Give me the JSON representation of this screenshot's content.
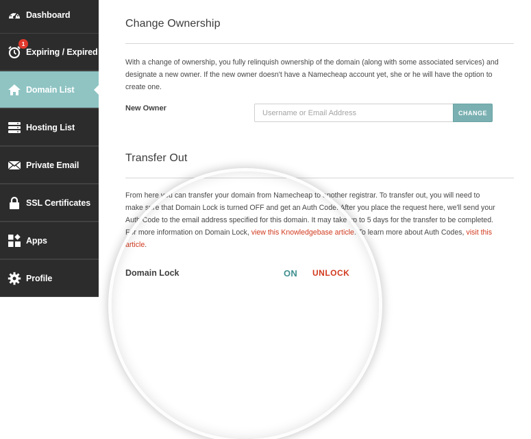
{
  "sidebar": {
    "items": [
      {
        "label": "Dashboard",
        "icon": "dashboard-gauge-icon"
      },
      {
        "label": "Expiring / Expired",
        "icon": "alarm-clock-icon",
        "badge": "1"
      },
      {
        "label": "Domain List",
        "icon": "home-icon",
        "active": true
      },
      {
        "label": "Hosting List",
        "icon": "server-icon"
      },
      {
        "label": "Private Email",
        "icon": "envelope-icon"
      },
      {
        "label": "SSL Certificates",
        "icon": "padlock-icon"
      },
      {
        "label": "Apps",
        "icon": "apps-grid-icon"
      },
      {
        "label": "Profile",
        "icon": "gear-icon"
      }
    ],
    "active_color": "#8fc4c3"
  },
  "change_ownership": {
    "title": "Change Ownership",
    "description": "With a change of ownership, you fully relinquish ownership of the domain (along with some associated services) and designate a new owner. If the new owner doesn't have a Namecheap account yet, she or he will have the option to create one.",
    "new_owner_label": "New Owner",
    "input_placeholder": "Username or Email Address",
    "input_value": "",
    "button_label": "CHANGE"
  },
  "transfer_out": {
    "title": "Transfer Out",
    "description_text": "From here you can transfer your domain from Namecheap to another registrar. To transfer out, you will need to make sure that Domain Lock is turned OFF and get an Auth Code. After you place the request here, we'll send your Auth Code to the email address specified for this domain. It may take up to 5 days for the transfer to be completed. For more information on Domain Lock, ",
    "link1": "view this Knowledgebase article",
    "description_mid": ". To learn more about Auth Codes, ",
    "link2": "visit this article",
    "description_end": ".",
    "domain_lock_label": "Domain Lock",
    "domain_lock_status": "ON",
    "unlock_label": "UNLOCK"
  },
  "colors": {
    "accent": "#7ab0b1",
    "link": "#d13a1e",
    "on_status": "#3f8f8f",
    "sidebar_bg": "#2c2c2c"
  }
}
